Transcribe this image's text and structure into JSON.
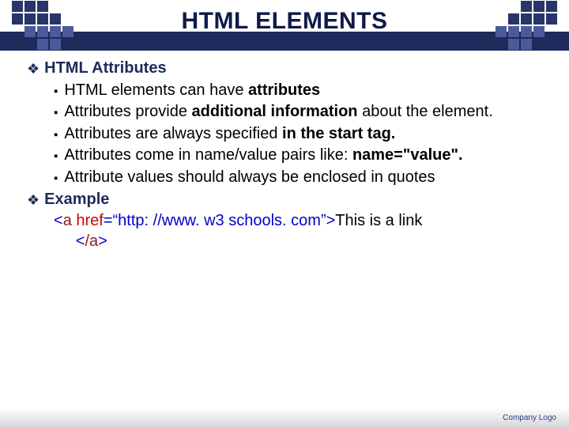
{
  "title": "HTML ELEMENTS",
  "section1": {
    "heading": "HTML Attributes",
    "bullets": {
      "b1_pre": "HTML elements can have ",
      "b1_bold": "attributes",
      "b2_pre": "Attributes provide ",
      "b2_bold": "additional information",
      "b2_post": " about the element.",
      "b3_pre": "Attributes are always specified ",
      "b3_bold": "in the start tag.",
      "b4_pre": "Attributes come in name/value pairs like: ",
      "b4_bold": "name=\"value\".",
      "b5": "Attribute values should always be enclosed in quotes"
    }
  },
  "section2": {
    "heading": "Example",
    "code": {
      "open_lt": "<",
      "tag_a": "a ",
      "href": "href",
      "eq_url": "=“http: //www. w3 schools. com”",
      "gt": ">",
      "linktext": "This is a link",
      "close_lt": "<",
      "close_slash_a": "/a",
      "close_gt": ">"
    }
  },
  "footer": "Company Logo"
}
